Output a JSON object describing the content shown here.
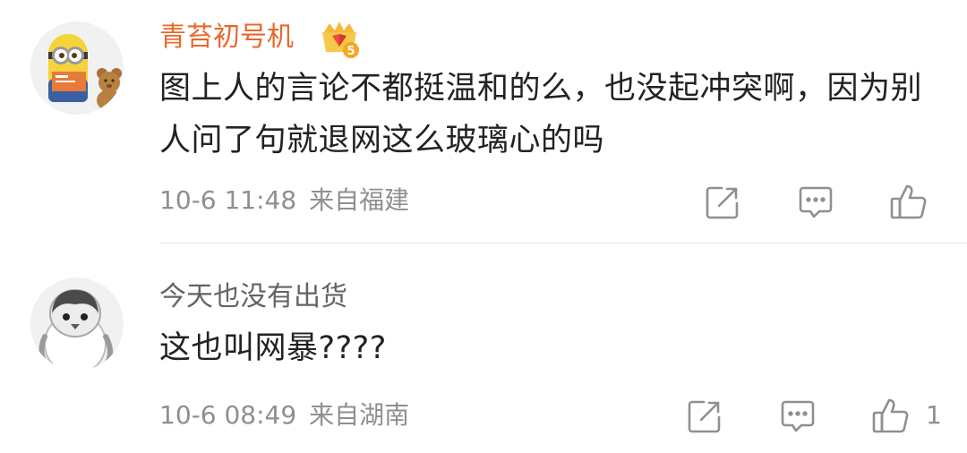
{
  "comments": [
    {
      "username": "青苔初号机",
      "badge_level": "5",
      "text": "图上人的言论不都挺温和的么，也没起冲突啊，因为别人问了句就退网这么玻璃心的吗",
      "time": "10-6 11:48",
      "location": "来自福建",
      "avatar_icon": "minion-avatar-icon",
      "username_color": "#e8682b"
    },
    {
      "username": "今天也没有出货",
      "text": "这也叫网暴????",
      "time": "10-6 08:49",
      "location": "来自湖南",
      "likes": "1",
      "avatar_icon": "penguin-avatar-icon",
      "username_color": "#636363"
    }
  ],
  "icons": {
    "share": "share-icon",
    "reply": "comment-icon",
    "like": "thumbs-up-icon"
  },
  "colors": {
    "text": "#222222",
    "meta": "#8f8f8f",
    "icon": "#8f8f8f",
    "divider": "#e6e6e6",
    "badge_gold": "#f5a623"
  }
}
